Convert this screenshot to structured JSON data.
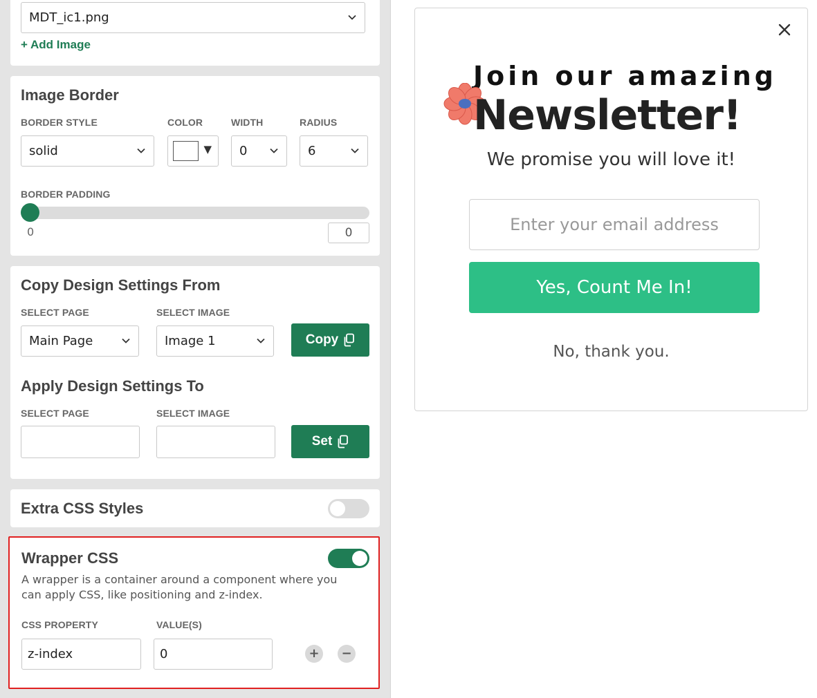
{
  "image_source": {
    "selected": "MDT_ic1.png",
    "add_link": "+ Add Image"
  },
  "image_border": {
    "title": "Image Border",
    "border_style_label": "BORDER STYLE",
    "border_style_value": "solid",
    "color_label": "COLOR",
    "color_value": "#ffffff",
    "width_label": "WIDTH",
    "width_value": "0",
    "radius_label": "RADIUS",
    "radius_value": "6",
    "padding_label": "BORDER PADDING",
    "padding_min": "0",
    "padding_value": "0",
    "padding_fraction": 0
  },
  "copy_settings": {
    "title": "Copy Design Settings From",
    "select_page_label": "SELECT PAGE",
    "select_page_value": "Main Page",
    "select_image_label": "SELECT IMAGE",
    "select_image_value": "Image 1",
    "copy_button": "Copy"
  },
  "apply_settings": {
    "title": "Apply Design Settings To",
    "select_page_label": "SELECT PAGE",
    "select_page_value": "",
    "select_image_label": "SELECT IMAGE",
    "select_image_value": "",
    "set_button": "Set"
  },
  "extra_css": {
    "title": "Extra CSS Styles",
    "enabled": false
  },
  "wrapper_css": {
    "title": "Wrapper CSS",
    "enabled": true,
    "description": "A wrapper is a container around a component where you can apply CSS, like positioning and z-index.",
    "property_label": "CSS PROPERTY",
    "value_label": "VALUE(S)",
    "property_value": "z-index",
    "value_value": "0",
    "add_symbol": "+",
    "remove_symbol": "−"
  },
  "preview": {
    "headline_line1": "Join our amazing",
    "headline_line2": "Newsletter!",
    "subtitle": "We promise you will love it!",
    "email_placeholder": "Enter your email address",
    "cta_label": "Yes, Count Me In!",
    "decline_label": "No, thank you."
  },
  "colors": {
    "accent_green": "#1f7d55",
    "cta_green": "#2dbf86",
    "highlight_red": "#e02020",
    "flower_pink": "#f07a6a",
    "flower_center": "#4a6fbf"
  }
}
